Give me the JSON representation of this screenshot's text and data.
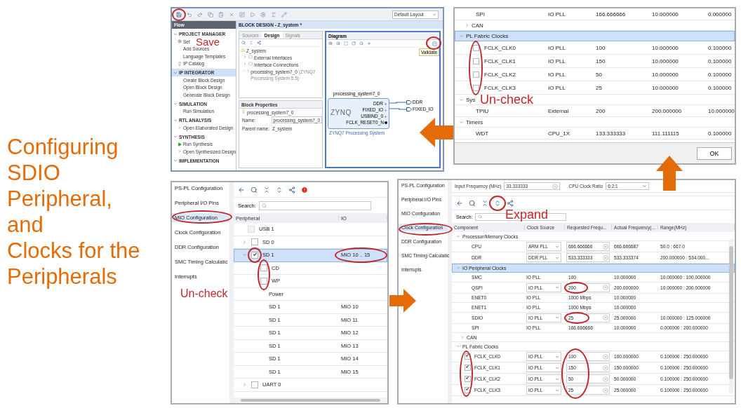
{
  "title": [
    "Configuring",
    "SDIO",
    "Peripheral,",
    "and",
    "Clocks for the",
    "Peripherals"
  ],
  "block_design": {
    "layout_select": "Default Layout",
    "annotation": "Save",
    "flow_navigator": {
      "header": "Flow",
      "sections": [
        {
          "label": "PROJECT MANAGER",
          "selected": false,
          "items": [
            {
              "label": "Set",
              "kind": "gear"
            },
            {
              "label": "Add Sources",
              "kind": "plain"
            },
            {
              "label": "Language Templates",
              "kind": "plain"
            },
            {
              "label": "IP Catalog",
              "kind": "pin"
            }
          ]
        },
        {
          "label": "IP INTEGRATOR",
          "selected": true,
          "items": [
            {
              "label": "Create Block Design",
              "kind": "plain"
            },
            {
              "label": "Open Block Design",
              "kind": "plain"
            },
            {
              "label": "Generate Block Design",
              "kind": "plain"
            }
          ]
        },
        {
          "label": "SIMULATION",
          "selected": false,
          "items": [
            {
              "label": "Run Simulation",
              "kind": "plain"
            }
          ]
        },
        {
          "label": "RTL ANALYSIS",
          "selected": false,
          "items": [
            {
              "label": "Open Elaborated Design",
              "kind": "expandable"
            }
          ]
        },
        {
          "label": "SYNTHESIS",
          "selected": false,
          "items": [
            {
              "label": "Run Synthesis",
              "kind": "run"
            },
            {
              "label": "Open Synthesized Design",
              "kind": "expandable"
            }
          ]
        },
        {
          "label": "IMPLEMENTATION",
          "selected": false
        }
      ]
    },
    "editor_title": "BLOCK DESIGN - Z_system *",
    "tabs": [
      {
        "label": "Sources",
        "selected": false
      },
      {
        "label": "Design",
        "selected": true
      },
      {
        "label": "Signals",
        "selected": false
      }
    ],
    "tree": {
      "label": "Z_system",
      "children": [
        {
          "label": "External Interfaces",
          "kind": "folder"
        },
        {
          "label": "Interface Connections",
          "kind": "folder"
        },
        {
          "label": "processing_system7_0",
          "kind": "ip",
          "note": "(ZYNQ7 Processing System 5.5)"
        }
      ]
    },
    "block_properties": {
      "title": "Block Properties",
      "selection": "processing_system7_0",
      "fields": [
        {
          "label": "Name:",
          "value": "processing_system7_0"
        },
        {
          "label": "Parent name:",
          "value": "Z_system"
        }
      ]
    },
    "diagram": {
      "title": "Diagram",
      "tooltip": "Validate",
      "block": {
        "name": "processing_system7_0",
        "logo": "ZYNQ",
        "caption": "ZYNQ7 Processing System",
        "ports": [
          {
            "name": "DDR",
            "kind": "bus"
          },
          {
            "name": "FIXED_IO",
            "kind": "bus"
          },
          {
            "name": "USBIND_0",
            "kind": "bus"
          },
          {
            "name": "FCLK_RESET0_N",
            "kind": "signal"
          }
        ]
      },
      "external_ports": [
        "DDR",
        "FIXED_IO"
      ]
    }
  },
  "clock_table_dialog": {
    "annotation": "Un-check",
    "ok_button": "OK",
    "rows": [
      {
        "kind": "clock",
        "component": "SPI",
        "source": "IO PLL",
        "requested": "166.666666",
        "actual": "10.000000",
        "range": "0.000000"
      },
      {
        "kind": "group",
        "label": "CAN",
        "expanded": false,
        "selected": false
      },
      {
        "kind": "group",
        "label": "PL Fabric Clocks",
        "expanded": true,
        "selected": true,
        "children": [
          {
            "kind": "fabric_clock",
            "checked": false,
            "component": "FCLK_CLK0",
            "source": "IO PLL",
            "requested": "100",
            "actual": "10.000000",
            "range": "0.100000"
          },
          {
            "kind": "fabric_clock",
            "checked": false,
            "component": "FCLK_CLK1",
            "source": "IO PLL",
            "requested": "150",
            "actual": "10.000000",
            "range": "0.100000"
          },
          {
            "kind": "fabric_clock",
            "checked": false,
            "component": "FCLK_CLK2",
            "source": "IO PLL",
            "requested": "50",
            "actual": "10.000000",
            "range": "0.100000"
          },
          {
            "kind": "fabric_clock",
            "checked": false,
            "component": "FCLK_CLK3",
            "source": "IO PLL",
            "requested": "25",
            "actual": "10.000000",
            "range": "0.100000"
          }
        ]
      },
      {
        "kind": "group",
        "label": "Sys",
        "expanded": true,
        "selected": false,
        "children": [
          {
            "kind": "clock",
            "component": "TPIU",
            "source": "External",
            "requested": "200",
            "actual": "200.000000",
            "range": "10.000000"
          }
        ]
      },
      {
        "kind": "group",
        "label": "Timers",
        "expanded": true,
        "selected": false,
        "children": [
          {
            "kind": "clock",
            "component": "WDT",
            "source": "CPU_1X",
            "requested": "133.333333",
            "actual": "111.111115",
            "range": "0.100000"
          }
        ]
      }
    ]
  },
  "mio_page": {
    "annotation": "Un-check",
    "search_label": "Search:",
    "columns": [
      "Peripheral",
      "IO"
    ],
    "nav": [
      {
        "label": "PS-PL Configuration",
        "selected": false
      },
      {
        "label": "Peripheral I/O Pins",
        "selected": false
      },
      {
        "label": "MIO Configuration",
        "selected": true
      },
      {
        "label": "Clock Configuration",
        "selected": false
      },
      {
        "label": "DDR Configuration",
        "selected": false
      },
      {
        "label": "SMC Timing Calculatic",
        "selected": false
      },
      {
        "label": "Interrupts",
        "selected": false
      }
    ],
    "rows": [
      {
        "kind": "check",
        "label": "USB 1",
        "checked": false,
        "disabled": true,
        "selected": false
      },
      {
        "kind": "check",
        "label": "SD 0",
        "checked": false,
        "disabled": false,
        "expanded": false,
        "selected": false
      },
      {
        "kind": "check",
        "label": "SD 1",
        "checked": true,
        "disabled": false,
        "expanded": true,
        "selected": true,
        "io": "MIO 10 .. 15",
        "children": [
          {
            "kind": "check",
            "label": "CD",
            "checked": false,
            "disabled": false,
            "selected": false
          },
          {
            "kind": "check",
            "label": "WP",
            "checked": false,
            "disabled": false,
            "selected": false
          },
          {
            "kind": "label",
            "label": "Power",
            "selected": false
          },
          {
            "kind": "pin",
            "label": "SD 1",
            "io": "MIO 10",
            "selected": false
          },
          {
            "kind": "pin",
            "label": "SD 1",
            "io": "MIO 11",
            "selected": false
          },
          {
            "kind": "pin",
            "label": "SD 1",
            "io": "MIO 12",
            "selected": false
          },
          {
            "kind": "pin",
            "label": "SD 1",
            "io": "MIO 13",
            "selected": false
          },
          {
            "kind": "pin",
            "label": "SD 1",
            "io": "MIO 14",
            "selected": false
          },
          {
            "kind": "pin",
            "label": "SD 1",
            "io": "MIO 15",
            "selected": false
          }
        ]
      },
      {
        "kind": "check",
        "label": "UART 0",
        "checked": false,
        "disabled": false,
        "expanded": false,
        "selected": false
      }
    ]
  },
  "clock_page": {
    "annotation": "Expand",
    "search_label": "Search:",
    "input_frequency": {
      "label": "Input Frequency (MHz)",
      "value": "33.333333"
    },
    "cpu_clock_ratio": {
      "label": "CPU Clock Ratio",
      "value": "6:2:1"
    },
    "nav": [
      {
        "label": "PS-PL Configuration",
        "selected": false
      },
      {
        "label": "Peripheral I/O Pins",
        "selected": false
      },
      {
        "label": "MIO Configuration",
        "selected": false
      },
      {
        "label": "Clock Configuration",
        "selected": true
      },
      {
        "label": "DDR Configuration",
        "selected": false
      },
      {
        "label": "SMC Timing Calculatic",
        "selected": false
      },
      {
        "label": "Interrupts",
        "selected": false
      }
    ],
    "columns": [
      "Component",
      "Clock Source",
      "Requested Frequ...",
      "Actual Frequency(...",
      "Range(MHz)"
    ],
    "rows": [
      {
        "kind": "group",
        "label": "Processor/Memory Clocks",
        "expanded": true,
        "selected": false,
        "children": [
          {
            "kind": "clock",
            "component": "CPU",
            "source": "ARM PLL",
            "editable": true,
            "requested": "666.666666",
            "actual": "666.666687",
            "range": "50.0 : 667.0"
          },
          {
            "kind": "clock",
            "component": "DDR",
            "source": "DDR PLL",
            "editable": true,
            "requested": "533.333333",
            "actual": "533.333374",
            "range": "200.000000 : 534.000..."
          }
        ]
      },
      {
        "kind": "group",
        "label": "IO Peripheral Clocks",
        "expanded": true,
        "selected": true,
        "children": [
          {
            "kind": "clock",
            "component": "SMC",
            "source": "IO PLL",
            "editable": false,
            "requested": "100",
            "actual": "10.000000",
            "range": "10.000000 : 100.000000"
          },
          {
            "kind": "clock",
            "component": "QSPI",
            "source": "IO PLL",
            "editable": true,
            "requested": "200",
            "actual": "200.000000",
            "range": "10.000000 : 200.000000"
          },
          {
            "kind": "clock",
            "component": "ENET0",
            "source": "IO PLL",
            "editable": false,
            "requested": "1000 Mbps",
            "actual": "10.000000"
          },
          {
            "kind": "clock",
            "component": "ENET1",
            "source": "IO PLL",
            "editable": false,
            "requested": "1000 Mbps",
            "actual": "10.000000"
          },
          {
            "kind": "clock",
            "component": "SDIO",
            "source": "IO PLL",
            "editable": true,
            "requested": "25",
            "actual": "25.000000",
            "range": "10.000000 : 125.000000"
          },
          {
            "kind": "clock",
            "component": "SPI",
            "source": "IO PLL",
            "editable": false,
            "requested": "166.666666",
            "actual": "10.000000",
            "range": "0.000000 : 200.000000"
          }
        ]
      },
      {
        "kind": "group",
        "label": "CAN",
        "expanded": false,
        "selected": false
      },
      {
        "kind": "group",
        "label": "PL Fabric Clocks",
        "expanded": true,
        "selected": false,
        "children": [
          {
            "kind": "fabric_clock",
            "checked": true,
            "component": "FCLK_CLK0",
            "source": "IO PLL",
            "editable": true,
            "requested": "100",
            "actual": "100.000000",
            "range": "0.100000 : 250.000000"
          },
          {
            "kind": "fabric_clock",
            "checked": true,
            "component": "FCLK_CLK1",
            "source": "IO PLL",
            "editable": true,
            "requested": "150",
            "actual": "150.000000",
            "range": "0.100000 : 250.000000"
          },
          {
            "kind": "fabric_clock",
            "checked": true,
            "component": "FCLK_CLK2",
            "source": "IO PLL",
            "editable": true,
            "requested": "50",
            "actual": "50.000000",
            "range": "0.100000 : 250.000000"
          },
          {
            "kind": "fabric_clock",
            "checked": true,
            "component": "FCLK_CLK3",
            "source": "IO PLL",
            "editable": true,
            "requested": "25",
            "actual": "25.000000",
            "range": "0.100000 : 250.000000"
          }
        ]
      }
    ]
  }
}
